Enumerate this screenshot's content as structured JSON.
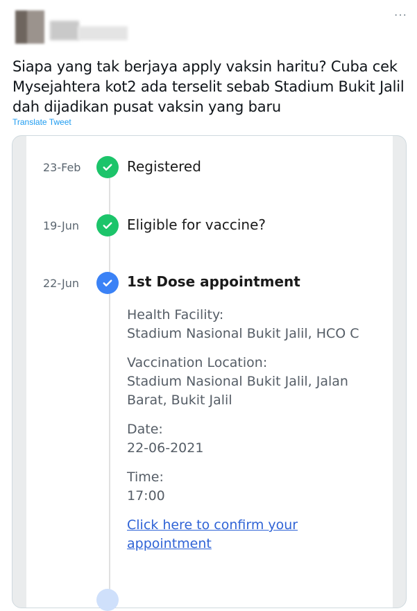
{
  "header": {
    "more_label": "···"
  },
  "tweet": {
    "text": "Siapa yang tak berjaya apply vaksin haritu? Cuba cek\nMysejahtera kot2 ada terselit sebab Stadium Bukit Jalil\ndah dijadikan pusat vaksin yang baru",
    "translate_label": "Translate Tweet"
  },
  "timeline": {
    "steps": [
      {
        "date": "23-Feb",
        "title": "Registered",
        "status": "done",
        "icon": "check-circle-icon"
      },
      {
        "date": "19-Jun",
        "title": "Eligible for vaccine?",
        "status": "done",
        "icon": "check-circle-icon"
      },
      {
        "date": "22-Jun",
        "title": "1st Dose appointment",
        "status": "current",
        "icon": "check-circle-icon"
      }
    ],
    "details": {
      "health_facility_label": "Health Facility:",
      "health_facility_value": "Stadium Nasional Bukit Jalil, HCO C",
      "location_label": "Vaccination Location:",
      "location_value_line1": "Stadium Nasional Bukit Jalil, Jalan",
      "location_value_line2": "Barat, Bukit Jalil",
      "date_label": "Date:",
      "date_value": "22-06-2021",
      "time_label": "Time:",
      "time_value": "17:00",
      "confirm_link_line1": "Click here to confirm your",
      "confirm_link_line2": "appointment"
    }
  },
  "colors": {
    "done": "#1cc46a",
    "current": "#3b82f6",
    "link": "#2f63d6",
    "twitter_blue": "#1d9bf0"
  }
}
